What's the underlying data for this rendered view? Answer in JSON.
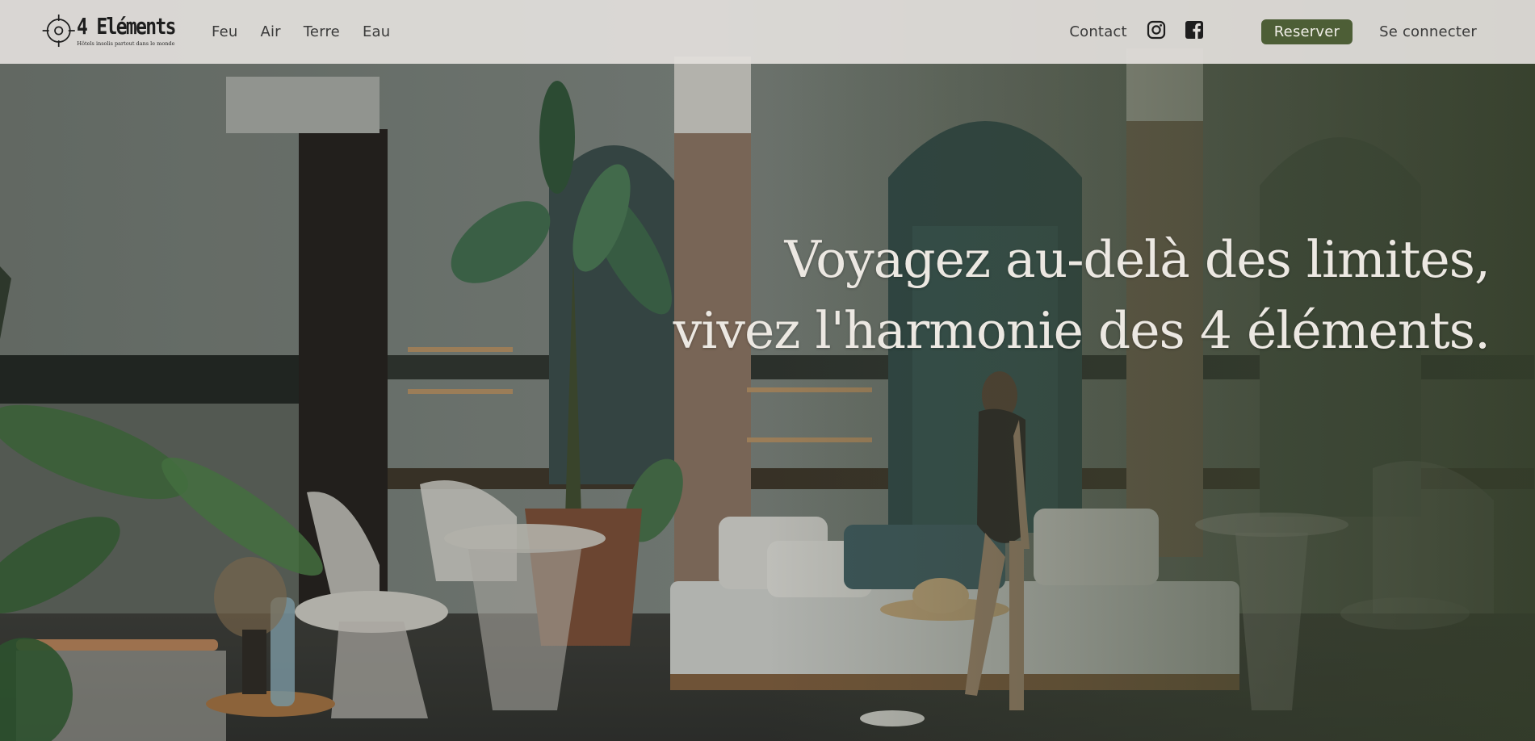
{
  "brand": {
    "name": "4 Eléments",
    "tagline": "Hôtels insolis partout dans le monde",
    "logo_icon": "crosshair-circle-icon"
  },
  "nav": {
    "left": [
      {
        "label": "Feu"
      },
      {
        "label": "Air"
      },
      {
        "label": "Terre"
      },
      {
        "label": "Eau"
      }
    ],
    "contact_label": "Contact",
    "instagram_icon": "instagram-icon",
    "facebook_icon": "facebook-icon",
    "reserve_label": "Reserver",
    "login_label": "Se connecter"
  },
  "hero": {
    "title_line1": "Voyagez au-delà des limites,",
    "title_line2": "vivez l'harmonie des 4 éléments."
  },
  "colors": {
    "header_bg": "#e2dfdb",
    "accent_green": "#4d5e36",
    "text_dark": "#3a3a3a",
    "hero_text": "#ece8e2"
  }
}
